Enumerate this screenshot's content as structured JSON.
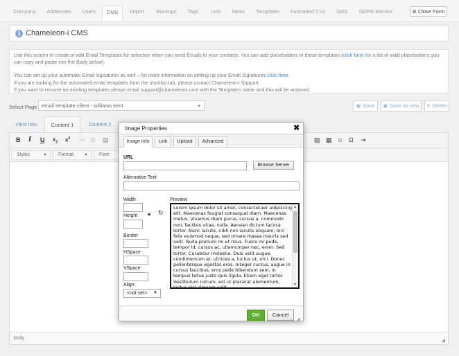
{
  "nav": {
    "tabs": [
      "Company",
      "Addresses",
      "Users",
      "CMS",
      "Import",
      "Backups",
      "Tags",
      "Lists",
      "News",
      "Templates",
      "Formatted CVs",
      "SMS",
      "GDPR Monitor"
    ],
    "active": "CMS",
    "close_label": "Close Form"
  },
  "title": {
    "icon": "info-icon",
    "text": "Chameleon-i CMS"
  },
  "info": {
    "p1_a": "Use this screen to create or edit Email Templates for selection when you send Emails to your contacts. You can add placeholders in these templates (",
    "p1_link": "click here",
    "p1_b": " for a list of valid placeholders you can copy and paste into the Body below).",
    "p2_a": "You can set up your automatic Email signatures as well – for more information on setting up your Email Signatures ",
    "p2_link": "click here",
    "p2_b": ".",
    "p3": "If you are looking for the automated email templates from the shortlist tab, please contact Chameleon-i Support.",
    "p4": "If you want to remove an existing templates please email support@chameleoni.com with the Templates name and this will be actioned."
  },
  "select_page": {
    "label": "Select Page",
    "value": "email template client - williams kent"
  },
  "actions": {
    "save": "Save",
    "save_as_new": "Save as new",
    "delete": "Delete"
  },
  "content_tabs": [
    "Html Info",
    "Content 1",
    "Content 2"
  ],
  "editor": {
    "styles": "Styles",
    "format": "Format",
    "font": "Font",
    "status": "body"
  },
  "dialog": {
    "title": "Image Properties",
    "tabs": [
      "Image Info",
      "Link",
      "Upload",
      "Advanced"
    ],
    "url_label": "URL",
    "browse_label": "Browse Server",
    "alt_label": "Alternative Text",
    "width_label": "Width",
    "height_label": "Height",
    "border_label": "Border",
    "hspace_label": "HSpace",
    "vspace_label": "VSpace",
    "align_label": "Align",
    "align_value": "<not set>",
    "preview_label": "Preview",
    "preview_text": "Lorem ipsum dolor sit amet, consectetuer adipiscing elit. Maecenas feugiat consequat diam. Maecenas metus. Vivamus diam purus, cursus a, commodo non, facilisis vitae, nulla. Aenean dictum lacinia tortor. Nunc iaculis, nibh non iaculis aliquam, orci felis euismod neque, sed ornare massa mauris sed velit. Nulla pretium mi et risus. Fusce mi pede, tempor id, cursus ac, ullamcorper nec, enim. Sed tortor. Curabitur molestie. Duis velit augue, condimentum at, ultrices a, luctus ut, orci. Donec pellentesque egestas eros. Integer cursus, augue in cursus faucibus, eros pede bibendum sem, in tempus tellus justo quis ligula. Etiam eget tortor. Vestibulum rutrum, est ut placerat elementum, lectus nisl aliquam velit",
    "ok_label": "OK",
    "cancel_label": "Cancel"
  },
  "colors": {
    "ok_green": "#5fb12c",
    "link_blue": "#3d8ad4",
    "info_icon": "#7aaee0"
  }
}
